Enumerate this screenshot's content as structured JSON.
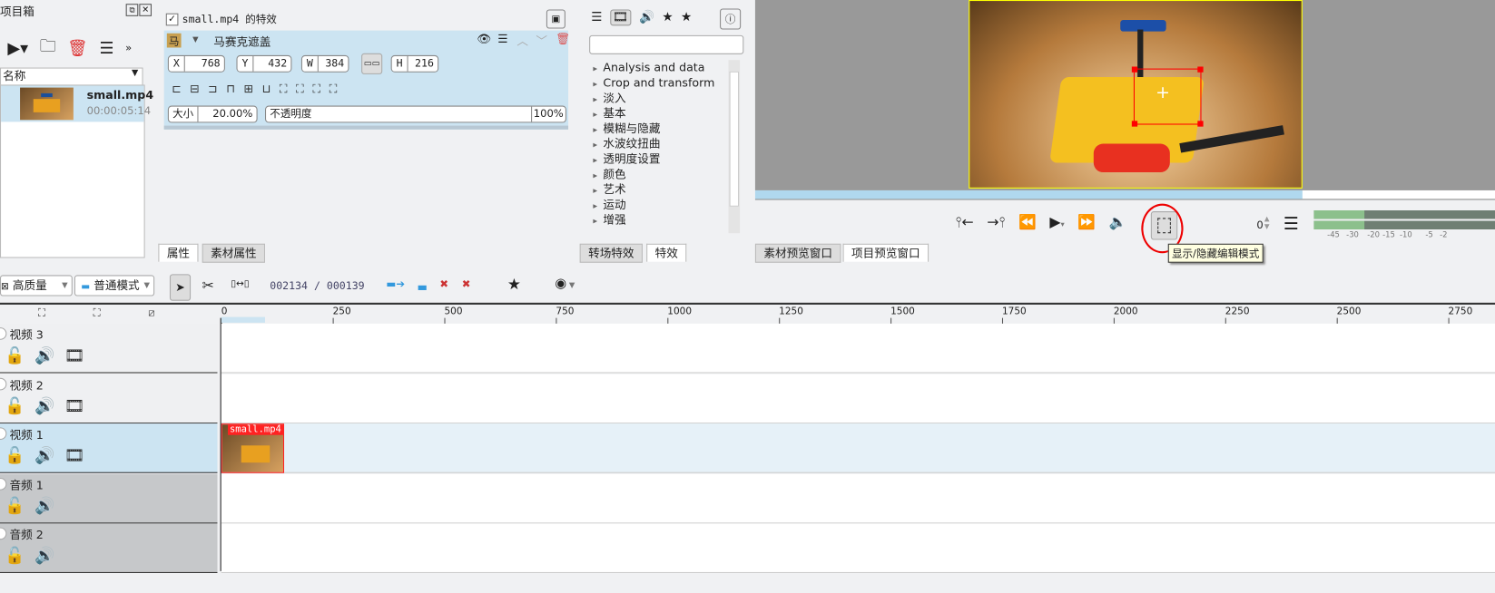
{
  "project_bin": {
    "title": "项目箱",
    "column_header": "名称",
    "items": [
      {
        "name": "small.mp4",
        "duration": "00:00:05:14"
      }
    ]
  },
  "effects_panel": {
    "enabled_label": "small.mp4 的特效",
    "effect": {
      "name": "马赛克遮盖",
      "icon_glyph": "马",
      "x_label": "X",
      "x": "768",
      "y_label": "Y",
      "y": "432",
      "w_label": "W",
      "w": "384",
      "h_label": "H",
      "h": "216",
      "size_label": "大小",
      "size": "20.00%",
      "opacity_label": "不透明度",
      "opacity": "100%",
      "opacity_fraction": 1.0
    },
    "tabs": [
      {
        "label": "属性"
      },
      {
        "label": "素材属性"
      }
    ]
  },
  "effects_library": {
    "categories": [
      "Analysis and data",
      "Crop and transform",
      "淡入",
      "基本",
      "模糊与隐藏",
      "水波纹扭曲",
      "透明度设置",
      "颜色",
      "艺术",
      "运动",
      "增强"
    ],
    "search_placeholder": "",
    "tabs": [
      {
        "label": "转场特效"
      },
      {
        "label": "特效"
      }
    ]
  },
  "monitor": {
    "tabs": [
      {
        "label": "素材预览窗口"
      },
      {
        "label": "项目预览窗口"
      }
    ],
    "volume": "0",
    "tooltip": "显示/隐藏编辑模式",
    "meter_ticks": [
      "-45",
      "-30",
      "-20",
      "-15",
      "-10",
      "-5",
      "-2"
    ],
    "meter_level_fraction": 0.28
  },
  "timeline_toolbar": {
    "quality": "高质量",
    "mode": "普通模式",
    "timecode": "002134 / 000139"
  },
  "timeline": {
    "ruler": [
      "0",
      "250",
      "500",
      "750",
      "1000",
      "1250",
      "1500",
      "1750",
      "2000",
      "2250",
      "2500",
      "2750"
    ],
    "tracks": [
      {
        "name": "视频 3",
        "type": "video"
      },
      {
        "name": "视频 2",
        "type": "video"
      },
      {
        "name": "视频 1",
        "type": "video"
      },
      {
        "name": "音频 1",
        "type": "audio"
      },
      {
        "name": "音频 2",
        "type": "audio"
      }
    ],
    "clip": {
      "label": "small.mp4"
    }
  },
  "colors": {
    "accent": "#cce4f2",
    "clip_border": "#ff2020",
    "selection": "#ff0000"
  }
}
